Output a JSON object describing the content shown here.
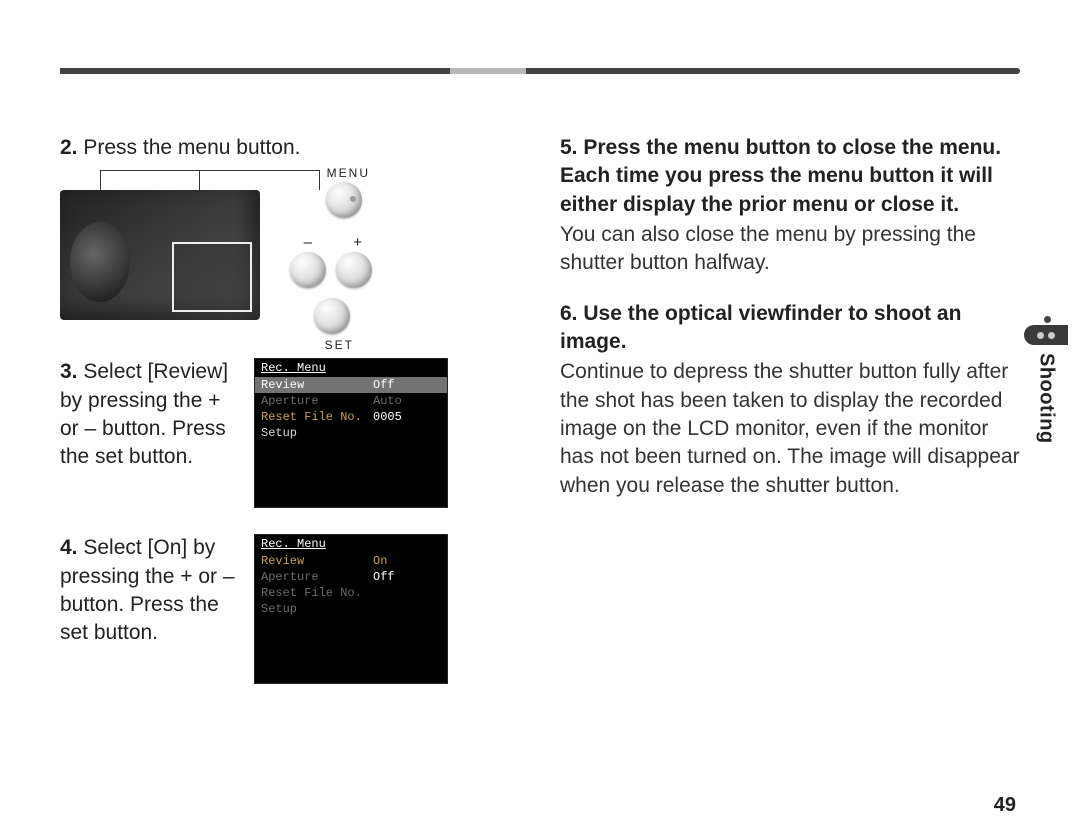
{
  "section_tab": "Shooting",
  "page_number": "49",
  "camera_labels": {
    "menu": "MENU",
    "set": "SET",
    "minus": "–",
    "plus": "+"
  },
  "steps": {
    "s2": {
      "n": "2.",
      "bold": "Press the menu button."
    },
    "s3": {
      "n": "3.",
      "bold_a": "Select [Review] by pressing the + or – button. Press the set button."
    },
    "s4": {
      "n": "4.",
      "bold_a": "Select [On] by pressing the + or – button. Press the set button."
    },
    "s5": {
      "n": "5.",
      "bold": "Press the menu button to close the menu. Each time you press the menu button it will either display the prior menu or close it.",
      "plain": "You can also close the menu by pressing the shutter button halfway."
    },
    "s6": {
      "n": "6.",
      "bold": "Use the optical viewfinder to shoot an image.",
      "plain": "Continue to depress the shutter button fully after the shot has been taken to display the recorded image on the LCD monitor, even if the monitor has not been turned on. The image will disappear when you release the shutter button."
    }
  },
  "screen1": {
    "title": "Rec. Menu",
    "rows": [
      {
        "label": "Review",
        "value": "Off",
        "style": "sel"
      },
      {
        "label": "Aperture",
        "value": "Auto",
        "style": "dim"
      },
      {
        "label": "Reset File No.",
        "value": "0005",
        "style": "yellow"
      },
      {
        "label": "Setup",
        "value": "",
        "style": ""
      }
    ]
  },
  "screen2": {
    "title": "Rec. Menu",
    "rows": [
      {
        "label": "Review",
        "value": "On",
        "style": "yellow-row"
      },
      {
        "label": "Aperture",
        "value": "Off",
        "style": "dim-mixed"
      },
      {
        "label": "Reset File No.",
        "value": "",
        "style": "dim"
      },
      {
        "label": "Setup",
        "value": "",
        "style": "dim"
      }
    ]
  }
}
